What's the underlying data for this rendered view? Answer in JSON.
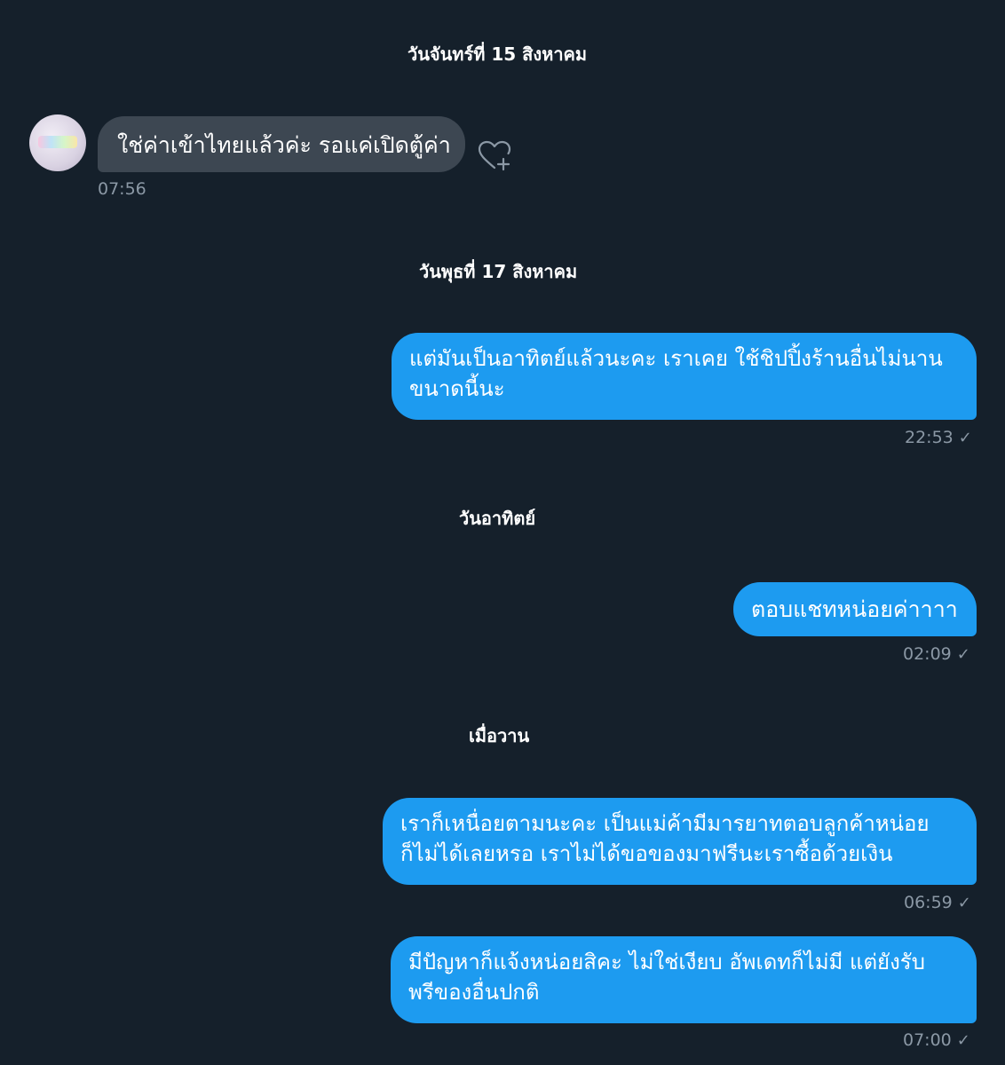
{
  "conversation": {
    "groups": [
      {
        "date_label": "วันจันทร์ที่ 15 สิงหาคม",
        "messages": [
          {
            "direction": "incoming",
            "lines": [
              "ใช่ค่าเข้าไทยแล้วค่ะ รอแค่เปิดตู้ค่า"
            ],
            "time": "07:56",
            "reaction_icon": "heart-plus-icon"
          }
        ]
      },
      {
        "date_label": "วันพุธที่ 17 สิงหาคม",
        "messages": [
          {
            "direction": "outgoing",
            "lines": [
              "แต่มันเป็นอาทิตย์แล้วนะคะ เราเคย ใช้ชิปปิ้งร้านอื่นไม่นาน",
              "ขนาดนี้นะ"
            ],
            "time": "22:53",
            "status_icon": "check-icon"
          }
        ]
      },
      {
        "date_label": "วันอาทิตย์",
        "messages": [
          {
            "direction": "outgoing",
            "lines": [
              "ตอบแชทหน่อยค่าาาา"
            ],
            "time": "02:09",
            "status_icon": "check-icon"
          }
        ]
      },
      {
        "date_label": "เมื่อวาน",
        "messages": [
          {
            "direction": "outgoing",
            "lines": [
              "เราก็เหนื่อยตามนะคะ เป็นแม่ค้ามีมารยาทตอบลูกค้าหน่อย",
              "ก็ไม่ได้เลยหรอ เราไม่ได้ขอของมาฟรีนะเราซื้อด้วยเงิน"
            ],
            "time": "06:59",
            "status_icon": "check-icon"
          },
          {
            "direction": "outgoing",
            "lines": [
              "มีปัญหาก็แจ้งหน่อยสิคะ ไม่ใช่เงียบ อัพเดทก็ไม่มี แต่ยังรับ",
              "พรีของอื่นปกติ"
            ],
            "time": "07:00",
            "status_icon": "check-icon"
          }
        ]
      }
    ]
  },
  "colors": {
    "background": "#15202b",
    "incoming_bubble": "#3d4752",
    "outgoing_bubble": "#1d9bf0",
    "timestamp": "#8b98a5"
  }
}
